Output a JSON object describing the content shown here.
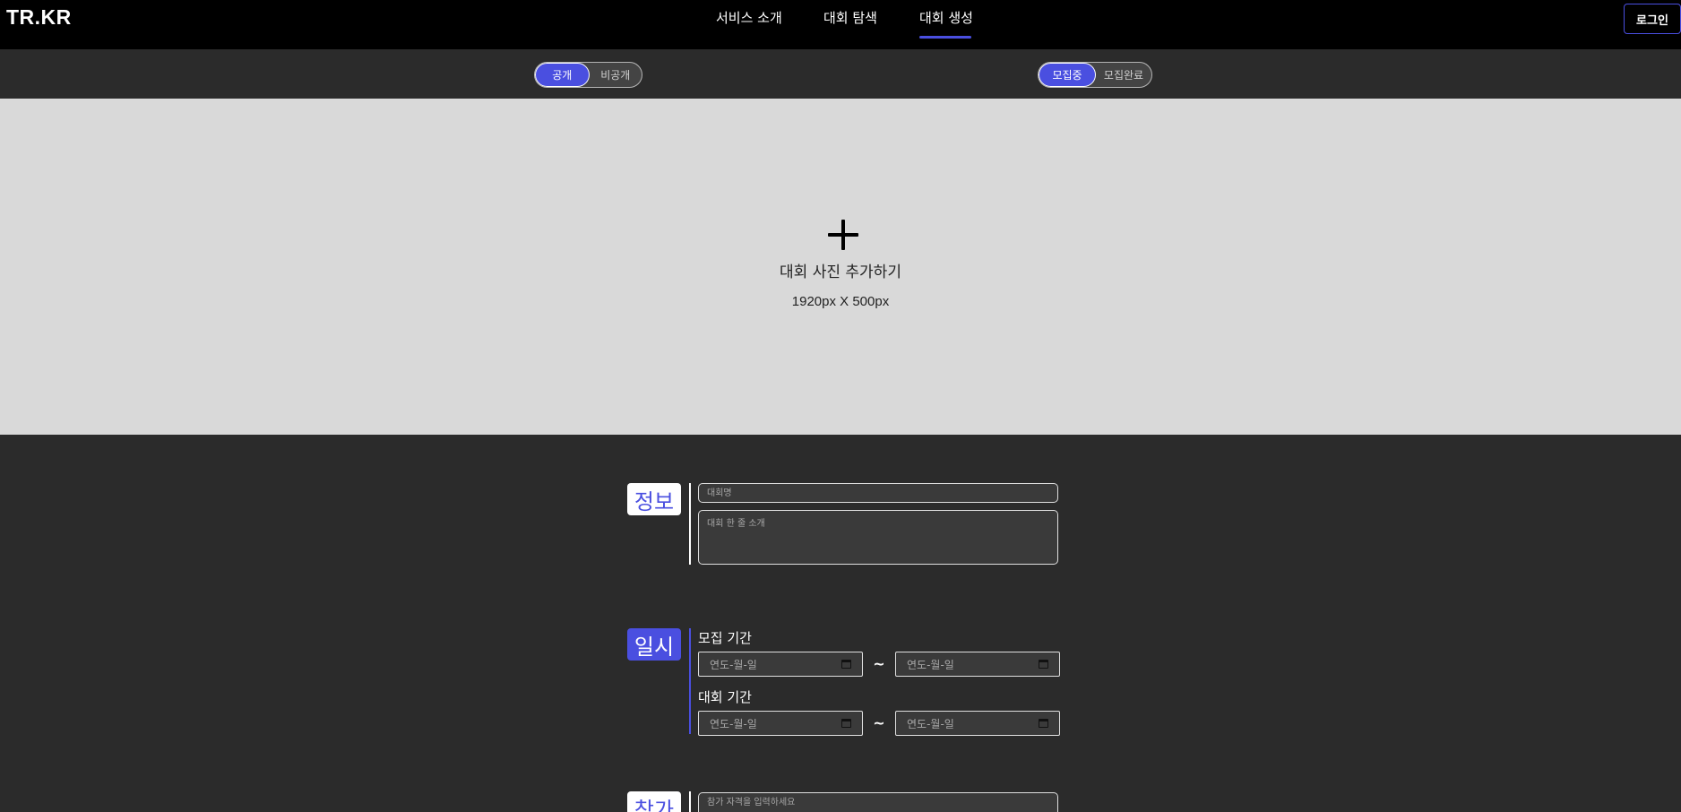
{
  "header": {
    "logo": "TR.KR",
    "nav": [
      "서비스 소개",
      "대회 탐색",
      "대회 생성"
    ],
    "active_nav": "대회 생성",
    "login_label": "로그인"
  },
  "toggles": {
    "visibility": {
      "options": [
        "공개",
        "비공개"
      ],
      "selected": "공개"
    },
    "recruit": {
      "options": [
        "모집중",
        "모집완료"
      ],
      "selected": "모집중"
    }
  },
  "photo": {
    "icon": "plus-icon",
    "title": "대회 사진 추가하기",
    "size": "1920px X 500px"
  },
  "info": {
    "badge": "정보",
    "name_placeholder": "대회명",
    "intro_placeholder": "대회 한 줄 소개"
  },
  "schedule": {
    "badge": "일시",
    "recruit_label": "모집 기간",
    "event_label": "대회 기간",
    "date_placeholder": "연도-월-일",
    "separator": "~"
  },
  "entry": {
    "badge": "참가",
    "qualification_placeholder": "참가 자격을 입력하세요"
  },
  "colors": {
    "accent": "#4a4fe0",
    "header_bg": "#000000",
    "page_bg": "#2b2b2b",
    "photo_bg": "#d9d9d9"
  }
}
